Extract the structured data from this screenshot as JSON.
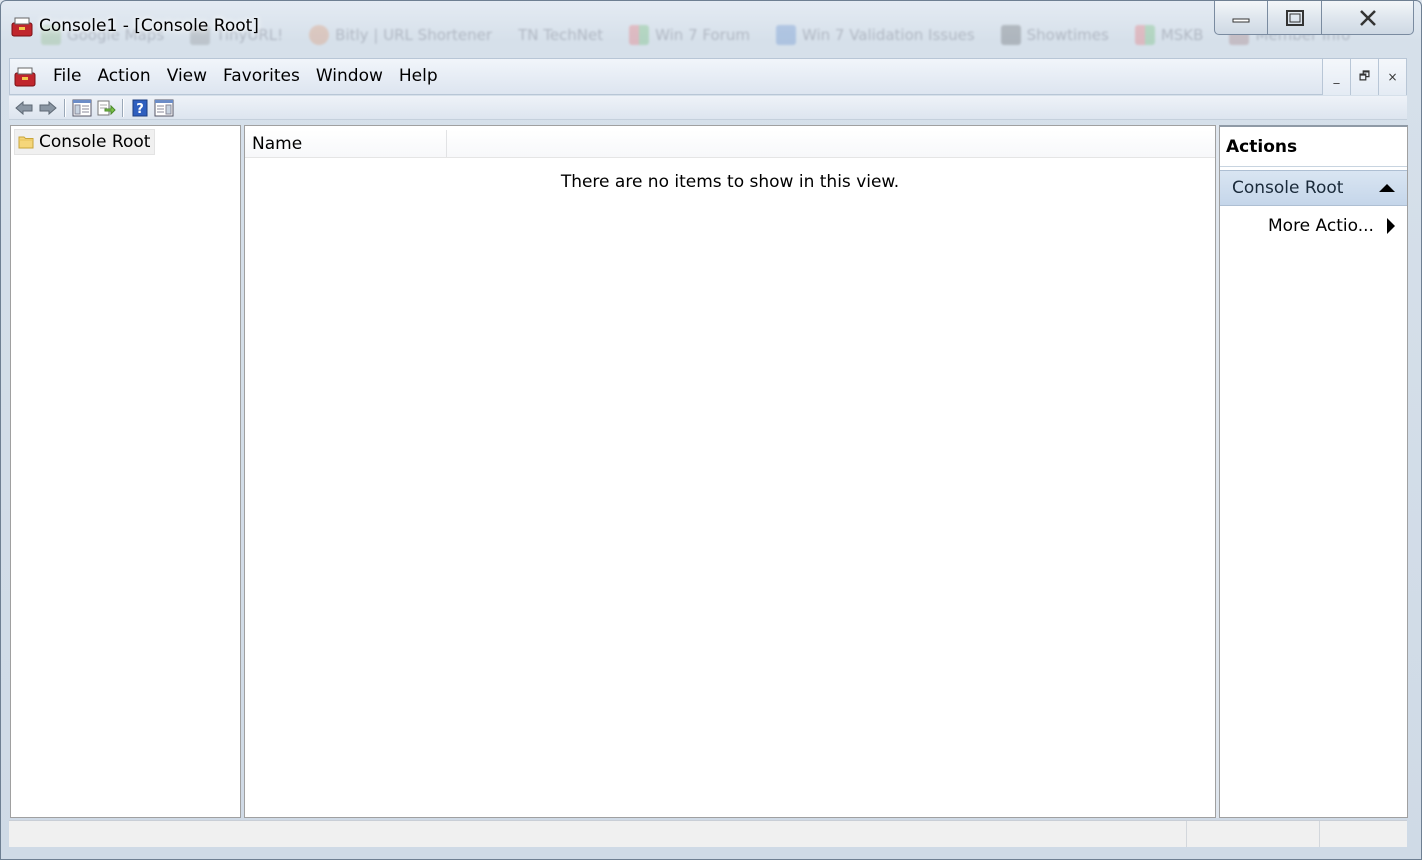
{
  "window": {
    "title": "Console1 - [Console Root]",
    "background_bookmarks": [
      "Google Maps",
      "TinyURL!",
      "Bitly | URL Shortener",
      "TN TechNet",
      "Win 7 Forum",
      "Win 7 Validation Issues",
      "Showtimes",
      "MSKB",
      "Member Info"
    ],
    "caption_buttons": {
      "minimize_icon": "minimize-icon",
      "maximize_icon": "maximize-icon",
      "close_icon": "close-icon"
    }
  },
  "menubar": {
    "items": [
      "File",
      "Action",
      "View",
      "Favorites",
      "Window",
      "Help"
    ],
    "mdi_buttons": {
      "minimize": "_",
      "restore": "🗗",
      "close": "×"
    }
  },
  "toolbar": {
    "buttons": [
      "back-arrow-icon",
      "forward-arrow-icon",
      "show-hide-console-tree-icon",
      "export-list-icon",
      "help-icon",
      "show-hide-action-pane-icon"
    ]
  },
  "tree": {
    "root_label": "Console Root",
    "root_icon": "folder-icon"
  },
  "list": {
    "columns": [
      "Name",
      ""
    ],
    "empty_message": "There are no items to show in this view."
  },
  "actions": {
    "title": "Actions",
    "section_title": "Console Root",
    "items": [
      {
        "label": "More Actio...",
        "has_submenu": true
      }
    ]
  },
  "colors": {
    "accent": "#c5d6ea",
    "frame": "#cfdae6",
    "folder": "#f5d67a"
  }
}
